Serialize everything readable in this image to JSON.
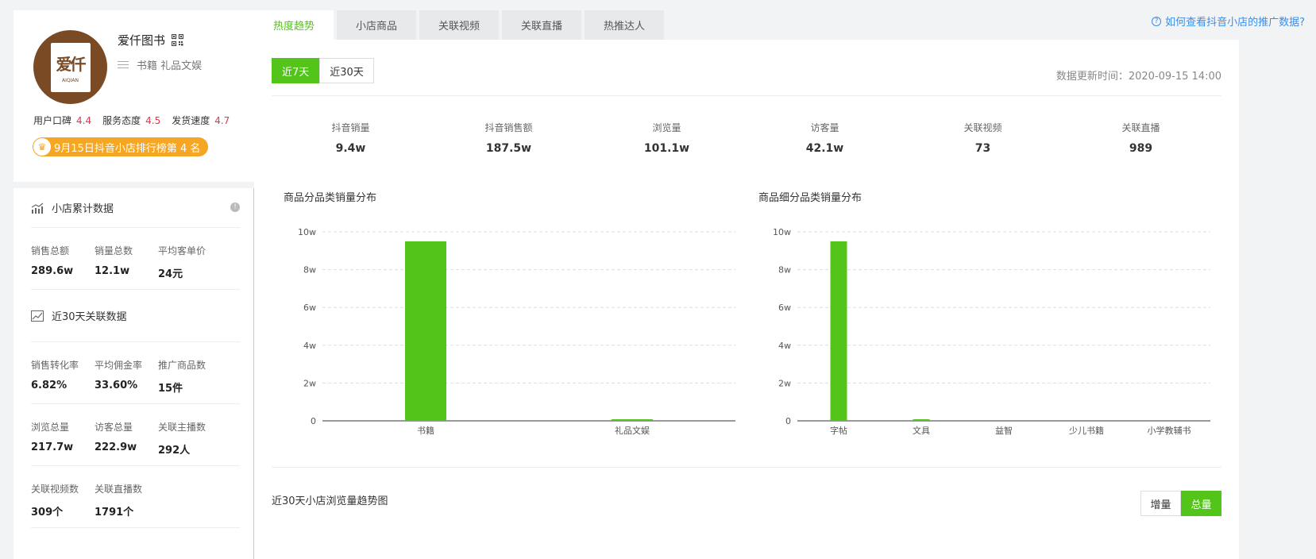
{
  "shop": {
    "name": "爱仟图书",
    "category": "书籍 礼品文娱",
    "avatar_text": "爱仟",
    "avatar_sub": "AIQIAN",
    "scores": [
      {
        "label": "用户口碑",
        "value": "4.4"
      },
      {
        "label": "服务态度",
        "value": "4.5"
      },
      {
        "label": "发货速度",
        "value": "4.7"
      }
    ],
    "rank_badge": "9月15日抖音小店排行榜第 4 名"
  },
  "cumulative": {
    "title": "小店累计数据",
    "stats": [
      {
        "label": "销售总额",
        "value": "289.6w"
      },
      {
        "label": "销量总数",
        "value": "12.1w"
      },
      {
        "label": "平均客单价",
        "value": "24元"
      }
    ]
  },
  "related30": {
    "title": "近30天关联数据",
    "rows": [
      [
        {
          "label": "销售转化率",
          "value": "6.82%"
        },
        {
          "label": "平均佣金率",
          "value": "33.60%"
        },
        {
          "label": "推广商品数",
          "value": "15件"
        }
      ],
      [
        {
          "label": "浏览总量",
          "value": "217.7w"
        },
        {
          "label": "访客总量",
          "value": "222.9w"
        },
        {
          "label": "关联主播数",
          "value": "292人"
        }
      ],
      [
        {
          "label": "关联视频数",
          "value": "309个"
        },
        {
          "label": "关联直播数",
          "value": "1791个"
        }
      ]
    ]
  },
  "tabs": [
    "热度趋势",
    "小店商品",
    "关联视频",
    "关联直播",
    "热推达人"
  ],
  "help_link": "如何查看抖音小店的推广数据?",
  "range_buttons": [
    "近7天",
    "近30天"
  ],
  "updated_at": "数据更新时间：2020-09-15 14:00",
  "kpis": [
    {
      "label": "抖音销量",
      "value": "9.4w"
    },
    {
      "label": "抖音销售额",
      "value": "187.5w"
    },
    {
      "label": "浏览量",
      "value": "101.1w"
    },
    {
      "label": "访客量",
      "value": "42.1w"
    },
    {
      "label": "关联视频",
      "value": "73"
    },
    {
      "label": "关联直播",
      "value": "989"
    }
  ],
  "chart_data": [
    {
      "type": "bar",
      "title": "商品分品类销量分布",
      "categories": [
        "书籍",
        "礼品文娱"
      ],
      "values": [
        95000,
        800
      ],
      "ylim": [
        0,
        100000
      ],
      "yticks": [
        "0",
        "2w",
        "4w",
        "6w",
        "8w",
        "10w"
      ],
      "grid": true,
      "color": "#52c41a"
    },
    {
      "type": "bar",
      "title": "商品细分品类销量分布",
      "categories": [
        "字帖",
        "文具",
        "益智",
        "少儿书籍",
        "小学教辅书"
      ],
      "values": [
        95000,
        800,
        0,
        0,
        0
      ],
      "ylim": [
        0,
        100000
      ],
      "yticks": [
        "0",
        "2w",
        "4w",
        "6w",
        "8w",
        "10w"
      ],
      "grid": true,
      "color": "#52c41a"
    }
  ],
  "trend": {
    "title": "近30天小店浏览量趋势图",
    "toggle": [
      "增量",
      "总量"
    ]
  }
}
